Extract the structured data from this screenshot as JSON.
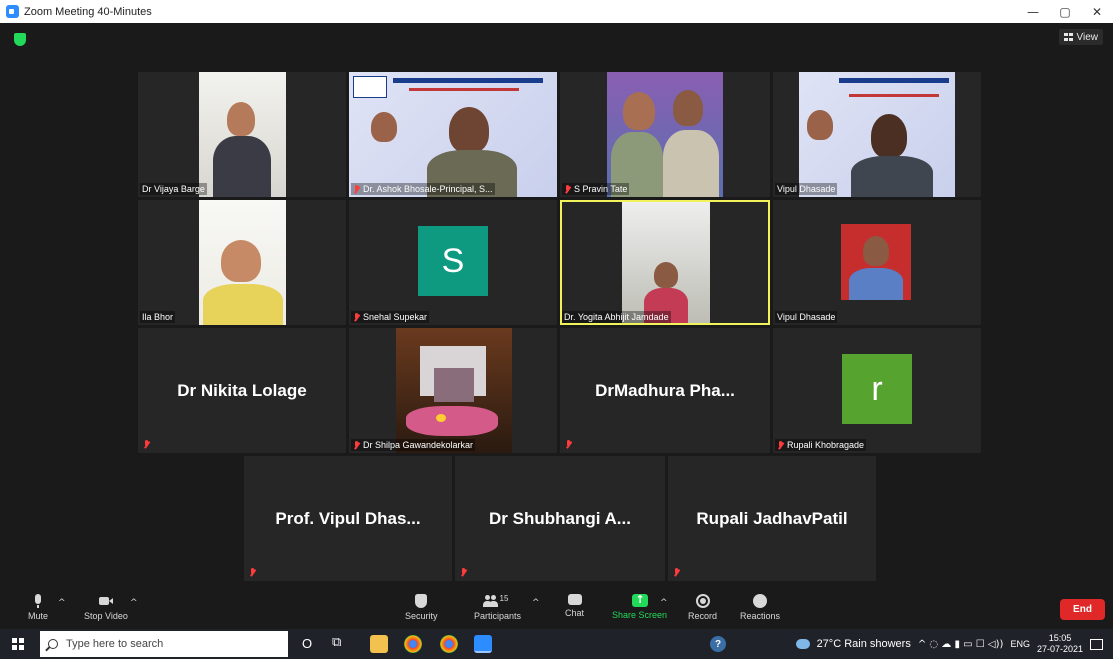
{
  "window": {
    "title": "Zoom Meeting 40-Minutes",
    "minimize": "—",
    "maximize": "▢",
    "close": "✕"
  },
  "view_button": {
    "label": "View"
  },
  "participants": [
    {
      "name": "Dr Vijaya Barge",
      "muted": false,
      "type": "video"
    },
    {
      "name": "Dr. Ashok Bhosale-Principal, S...",
      "muted": true,
      "type": "video"
    },
    {
      "name": "S Pravin Tate",
      "muted": true,
      "type": "video"
    },
    {
      "name": "Vipul Dhasade",
      "muted": false,
      "type": "video"
    },
    {
      "name": "Ila Bhor",
      "muted": false,
      "type": "video"
    },
    {
      "name": "Snehal Supekar",
      "muted": true,
      "type": "avatar",
      "letter": "S",
      "color": "#0e9a80"
    },
    {
      "name": "Dr. Yogita Abhijit Jamdade",
      "muted": false,
      "type": "video",
      "active": true
    },
    {
      "name": "Vipul Dhasade",
      "muted": false,
      "type": "video"
    },
    {
      "name": "Dr Nikita Lolage",
      "muted": true,
      "type": "name-only"
    },
    {
      "name": "Dr Shilpa Gawandekolarkar",
      "muted": true,
      "type": "video"
    },
    {
      "name": "DrMadhura  Pha...",
      "muted": true,
      "type": "name-only"
    },
    {
      "name": "Rupali Khobragade",
      "muted": true,
      "type": "avatar",
      "letter": "r",
      "color": "#56a330"
    },
    {
      "name": "Prof. Vipul  Dhas...",
      "muted": true,
      "type": "name-only"
    },
    {
      "name": "Dr Shubhangi  A...",
      "muted": true,
      "type": "name-only"
    },
    {
      "name": "Rupali JadhavPatil",
      "muted": true,
      "type": "name-only"
    }
  ],
  "toolbar": {
    "mute": "Mute",
    "stop_video": "Stop Video",
    "security": "Security",
    "participants": "Participants",
    "participants_count": "15",
    "chat": "Chat",
    "share_screen": "Share Screen",
    "record": "Record",
    "reactions": "Reactions",
    "end": "End",
    "caret": "^"
  },
  "taskbar": {
    "search_placeholder": "Type here to search",
    "weather": "27°C  Rain showers",
    "tray_glyphs": "^  ◌  ☁  ▮  ▭  ☐  ◁))",
    "language": "ENG",
    "time": "15:05",
    "date": "27-07-2021",
    "help": "?",
    "cortana": "O",
    "taskview": "⧉"
  },
  "colors": {
    "accent_green": "#23d959",
    "end_red": "#e02828",
    "active_border": "#f0f35a"
  }
}
